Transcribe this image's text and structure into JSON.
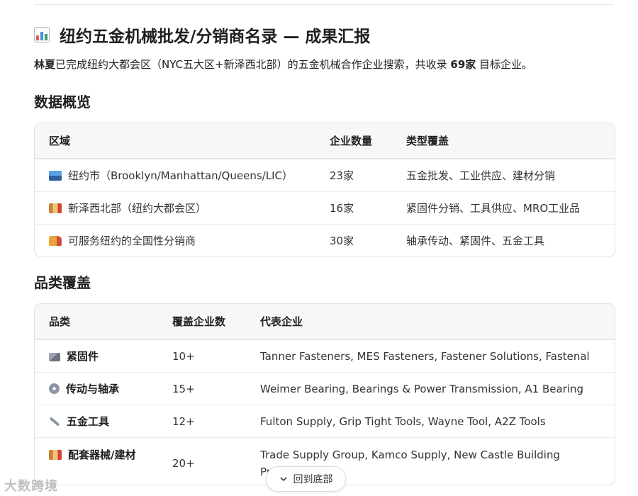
{
  "report": {
    "title_icon": "bar-chart-icon",
    "title": "纽约五金机械批发/分销商名录 — 成果汇报",
    "intro": {
      "name": "林夏",
      "text_before": "已完成纽约大都会区（NYC五大区+新泽西北部）的五金机械合作企业搜索，共收录 ",
      "count": "69家",
      "text_after": " 目标企业。"
    }
  },
  "overview": {
    "heading": "数据概览",
    "columns": [
      "区域",
      "企业数量",
      "类型覆盖"
    ],
    "rows": [
      {
        "icon": "cityscape-icon",
        "region": "纽约市（Brooklyn/Manhattan/Queens/LIC）",
        "count": "23家",
        "types": "五金批发、工业供应、建材分销"
      },
      {
        "icon": "factory-icon",
        "region": "新泽西北部（纽约大都会区）",
        "count": "16家",
        "types": "紧固件分销、工具供应、MRO工业品"
      },
      {
        "icon": "delivery-truck-icon",
        "region": "可服务纽约的全国性分销商",
        "count": "30家",
        "types": "轴承传动、紧固件、五金工具"
      }
    ]
  },
  "categories": {
    "heading": "品类覆盖",
    "columns": [
      "品类",
      "覆盖企业数",
      "代表企业"
    ],
    "rows": [
      {
        "icon": "nut-bolt-icon",
        "name": "紧固件",
        "count": "10+",
        "companies": "Tanner Fasteners, MES Fasteners, Fastener Solutions, Fastenal"
      },
      {
        "icon": "gear-icon",
        "name": "传动与轴承",
        "count": "15+",
        "companies": "Weimer Bearing, Bearings & Power Transmission, A1 Bearing"
      },
      {
        "icon": "wrench-icon",
        "name": "五金工具",
        "count": "12+",
        "companies": "Fulton Supply, Grip Tight Tools, Wayne Tool, A2Z Tools"
      },
      {
        "icon": "factory-icon",
        "name": "配套器械/建材",
        "count": "20+",
        "companies": "Trade Supply Group, Kamco Supply, New Castle Building Products"
      }
    ]
  },
  "scroll_button": {
    "icon": "chevron-down-icon",
    "label": "回到底部"
  },
  "watermark": "大数跨境",
  "colors": {
    "border": "#e2e2e2",
    "header_bg": "#f6f7f8",
    "text": "#1f1f1f"
  }
}
